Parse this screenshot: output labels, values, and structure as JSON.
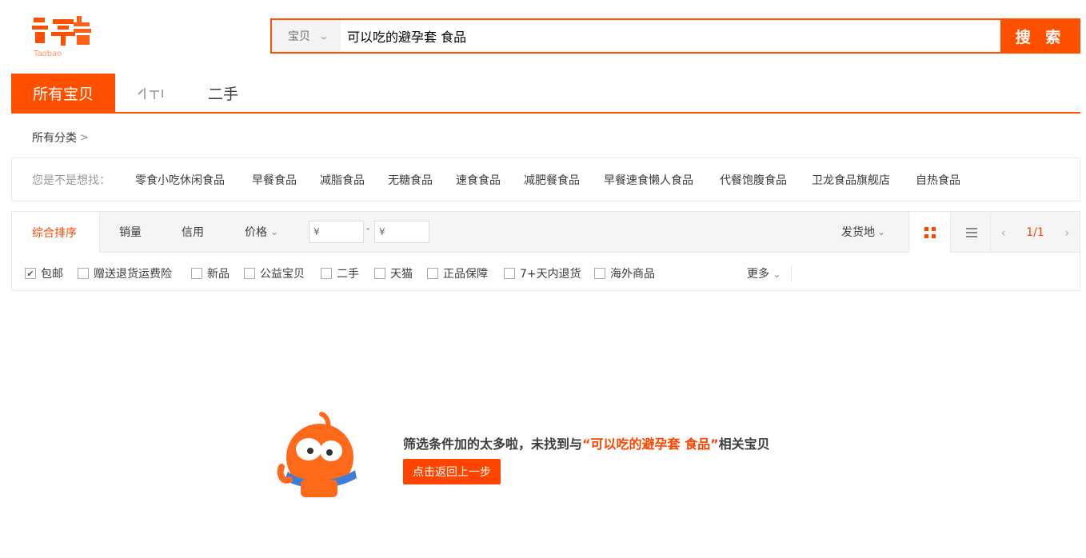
{
  "search": {
    "scope": "宝贝",
    "query": "可以吃的避孕套 食品",
    "button": "搜 索"
  },
  "tabs": [
    "所有宝贝",
    "天猫",
    "二手"
  ],
  "breadcrumb": "所有分类",
  "suggest": {
    "label": "您是不是想找：",
    "items": [
      "零食小吃休闲食品",
      "早餐食品",
      "减脂食品",
      "无糖食品",
      "速食食品",
      "减肥餐食品",
      "早餐速食懒人食品",
      "代餐饱腹食品",
      "卫龙食品旗舰店",
      "自热食品"
    ]
  },
  "sort": {
    "items": [
      "综合排序",
      "销量",
      "信用",
      "价格"
    ],
    "price_min_placeholder": "¥",
    "price_max_placeholder": "¥",
    "ship_from": "发货地",
    "page": "1/1"
  },
  "filters": {
    "items": [
      "包邮",
      "赠送退货运费险",
      "新品",
      "公益宝贝",
      "二手",
      "天猫",
      "正品保障",
      "7+天内退货",
      "海外商品"
    ],
    "checked": [
      true,
      false,
      false,
      false,
      false,
      false,
      false,
      false,
      false
    ],
    "more": "更多"
  },
  "empty": {
    "prefix": "筛选条件加的太多啦，未找到与",
    "keyword": "“可以吃的避孕套 食品”",
    "suffix": "相关宝贝",
    "back": "点击返回上一步"
  },
  "colors": {
    "accent": "#ff5000",
    "highlight": "#ff4400"
  }
}
